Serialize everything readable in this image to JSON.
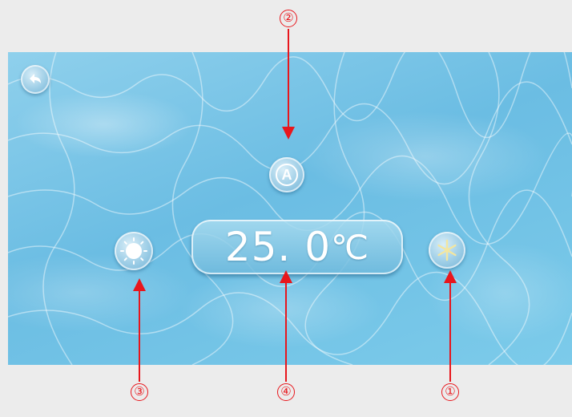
{
  "screen": {
    "temperature": {
      "value": "25. 0",
      "unit": "℃"
    },
    "buttons": {
      "back": {
        "icon": "back-arrow-icon"
      },
      "auto_mode": {
        "icon": "auto-mode-icon",
        "label": "A"
      },
      "heating": {
        "icon": "sun-icon"
      },
      "cooling": {
        "icon": "snowflake-icon"
      }
    }
  },
  "callouts": {
    "c1": "①",
    "c2": "②",
    "c3": "③",
    "c4": "④"
  },
  "colors": {
    "water": "#6bbde3",
    "callout": "#e8161c",
    "background": "#ececec"
  }
}
